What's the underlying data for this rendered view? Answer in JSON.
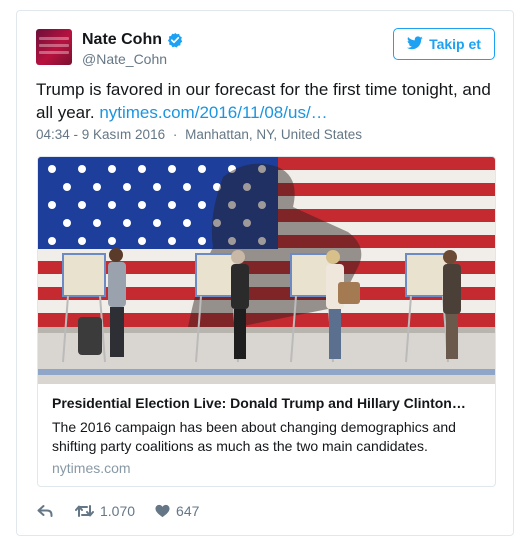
{
  "tweet": {
    "author_name": "Nate Cohn",
    "author_handle": "@Nate_Cohn",
    "follow_label": "Takip et",
    "text": "Trump is favored in our forecast for the first time tonight, and all year. ",
    "link_text": "nytimes.com/2016/11/08/us/…",
    "time": "04:34 - 9 Kasım 2016",
    "separator": "·",
    "location": "Manhattan, NY, United States"
  },
  "preview": {
    "title": "Presidential Election Live: Donald Trump and Hillary Clinton…",
    "description": "The 2016 campaign has been about changing demographics and shifting party coalitions as much as the two main candidates.",
    "domain": "nytimes.com"
  },
  "actions": {
    "retweet_count": "1.070",
    "like_count": "647"
  },
  "colors": {
    "accent": "#1da1f2",
    "link": "#1b95e0",
    "muted": "#657786",
    "border": "#e1e8ed"
  },
  "icons": [
    "verified-badge-icon",
    "twitter-bird-icon",
    "reply-icon",
    "retweet-icon",
    "heart-icon"
  ]
}
